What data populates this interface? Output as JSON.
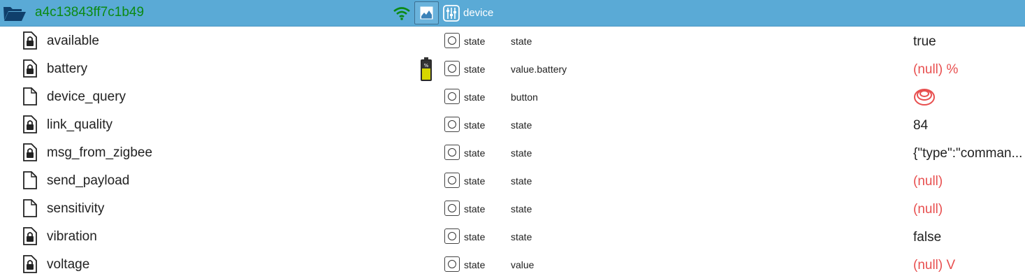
{
  "header": {
    "device_id": "a4c13843ff7c1b49",
    "role_label": "device",
    "icons": [
      "folder-open-icon",
      "wifi-icon",
      "image-icon",
      "sliders-icon"
    ],
    "colors": {
      "bar": "#5aaad6",
      "device_id": "#0b8a13",
      "wifi": "#0b8a13"
    }
  },
  "rows": [
    {
      "name": "available",
      "locked": true,
      "type": "state",
      "role": "state",
      "value": "true",
      "is_null": false
    },
    {
      "name": "battery",
      "locked": true,
      "type": "state",
      "role": "value.battery",
      "value": "(null) %",
      "is_null": true,
      "icon": "battery-icon"
    },
    {
      "name": "device_query",
      "locked": false,
      "type": "state",
      "role": "button",
      "value": "",
      "is_null": false,
      "value_icon": "push-button-icon"
    },
    {
      "name": "link_quality",
      "locked": true,
      "type": "state",
      "role": "state",
      "value": "84",
      "is_null": false
    },
    {
      "name": "msg_from_zigbee",
      "locked": true,
      "type": "state",
      "role": "state",
      "value": "{\"type\":\"comman...",
      "is_null": false
    },
    {
      "name": "send_payload",
      "locked": false,
      "type": "state",
      "role": "state",
      "value": "(null)",
      "is_null": true
    },
    {
      "name": "sensitivity",
      "locked": false,
      "type": "state",
      "role": "state",
      "value": "(null)",
      "is_null": true
    },
    {
      "name": "vibration",
      "locked": true,
      "type": "state",
      "role": "state",
      "value": "false",
      "is_null": false
    },
    {
      "name": "voltage",
      "locked": true,
      "type": "state",
      "role": "value",
      "value": "(null) V",
      "is_null": true
    }
  ],
  "colors": {
    "null_value": "#e85050"
  }
}
